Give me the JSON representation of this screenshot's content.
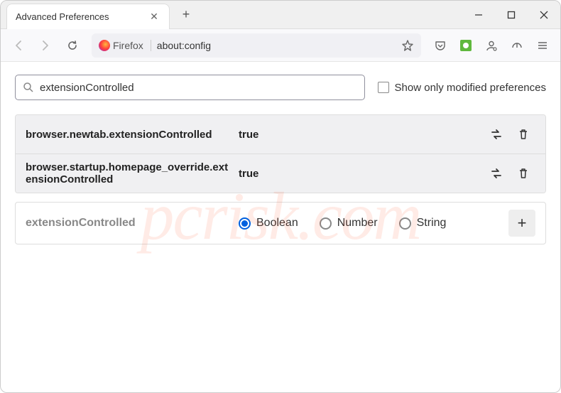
{
  "window": {
    "tab_title": "Advanced Preferences"
  },
  "urlbar": {
    "identity_label": "Firefox",
    "url": "about:config"
  },
  "search": {
    "value": "extensionControlled",
    "checkbox_label": "Show only modified preferences"
  },
  "prefs": [
    {
      "name": "browser.newtab.extensionControlled",
      "value": "true"
    },
    {
      "name": "browser.startup.homepage_override.extensionControlled",
      "value": "true"
    }
  ],
  "new_pref": {
    "name": "extensionControlled",
    "types": [
      {
        "label": "Boolean",
        "selected": true
      },
      {
        "label": "Number",
        "selected": false
      },
      {
        "label": "String",
        "selected": false
      }
    ]
  },
  "watermark": "pcrisk.com"
}
